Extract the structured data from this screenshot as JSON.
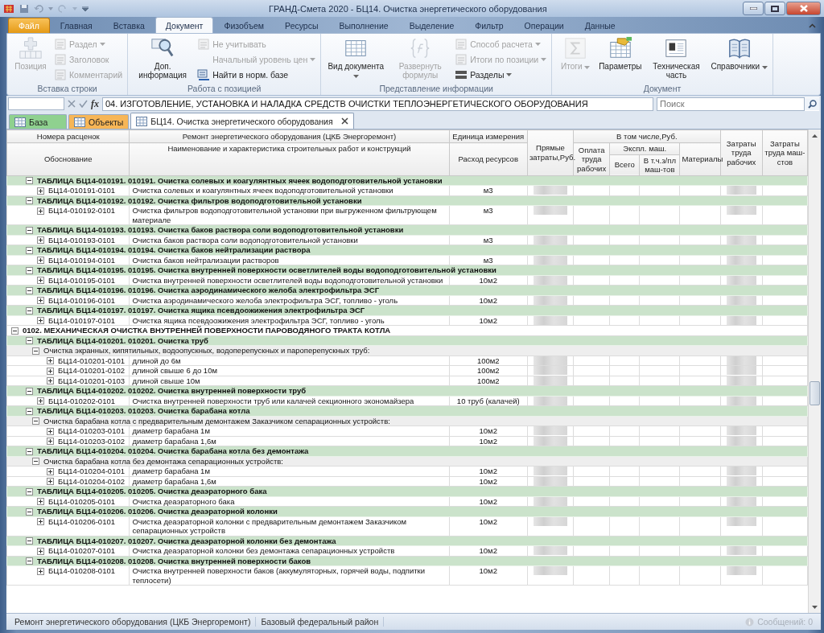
{
  "window": {
    "title": "ГРАНД-Смета 2020 - БЦ14. Очистка энергетического оборудования"
  },
  "ribbon": {
    "tabs": [
      {
        "label": "Файл",
        "kind": "file",
        "selected": false
      },
      {
        "label": "Главная",
        "kind": "tab",
        "selected": false
      },
      {
        "label": "Вставка",
        "kind": "tab",
        "selected": false
      },
      {
        "label": "Документ",
        "kind": "tab",
        "selected": true
      },
      {
        "label": "Физобъем",
        "kind": "tab",
        "selected": false
      },
      {
        "label": "Ресурсы",
        "kind": "tab",
        "selected": false
      },
      {
        "label": "Выполнение",
        "kind": "tab",
        "selected": false
      },
      {
        "label": "Выделение",
        "kind": "tab",
        "selected": false
      },
      {
        "label": "Фильтр",
        "kind": "tab",
        "selected": false
      },
      {
        "label": "Операции",
        "kind": "tab",
        "selected": false
      },
      {
        "label": "Данные",
        "kind": "tab",
        "selected": false
      }
    ],
    "groups": [
      {
        "title": "Вставка строки",
        "items": [
          {
            "kind": "large",
            "label": "Позиция",
            "disabled": true,
            "dropdown": false
          },
          {
            "kind": "small",
            "label": "Раздел",
            "disabled": true,
            "dropdown": true
          },
          {
            "kind": "small",
            "label": "Заголовок",
            "disabled": true,
            "dropdown": false
          },
          {
            "kind": "small",
            "label": "Комментарий",
            "disabled": true,
            "dropdown": false
          }
        ]
      },
      {
        "title": "Работа с позицией",
        "items": [
          {
            "kind": "large",
            "label": "Доп. информация",
            "disabled": false,
            "dropdown": false
          },
          {
            "kind": "small",
            "label": "Не учитывать",
            "disabled": true,
            "dropdown": false
          },
          {
            "kind": "small",
            "label": "Начальный уровень цен",
            "disabled": true,
            "dropdown": true
          },
          {
            "kind": "small",
            "label": "Найти в норм. базе",
            "disabled": false,
            "dropdown": false
          }
        ]
      },
      {
        "title": "Представление информации",
        "items": [
          {
            "kind": "large",
            "label": "Вид документа",
            "disabled": false,
            "dropdown": true
          },
          {
            "kind": "large",
            "label": "Развернуть формулы",
            "disabled": true,
            "dropdown": false
          },
          {
            "kind": "small",
            "label": "Способ расчета",
            "disabled": true,
            "dropdown": true
          },
          {
            "kind": "small",
            "label": "Итоги по позиции",
            "disabled": true,
            "dropdown": true
          },
          {
            "kind": "small",
            "label": "Разделы",
            "disabled": false,
            "dropdown": true
          }
        ]
      },
      {
        "title": "Документ",
        "items": [
          {
            "kind": "large",
            "label": "Итоги",
            "disabled": true,
            "dropdown": true
          },
          {
            "kind": "large",
            "label": "Параметры",
            "disabled": false,
            "dropdown": false
          },
          {
            "kind": "large",
            "label": "Техническая часть",
            "disabled": false,
            "dropdown": false
          },
          {
            "kind": "large",
            "label": "Справочники",
            "disabled": false,
            "dropdown": true
          }
        ]
      }
    ]
  },
  "formula_bar": {
    "function_label": "fx",
    "value": "04. ИЗГОТОВЛЕНИЕ, УСТАНОВКА И НАЛАДКА СРЕДСТВ ОЧИСТКИ ТЕПЛОЭНЕРГЕТИЧЕСКОГО ОБОРУДОВАНИЯ",
    "search_placeholder": "Поиск"
  },
  "doc_tabs": [
    {
      "label": "База",
      "selected": false,
      "color": "#8fd18f"
    },
    {
      "label": "Объекты",
      "selected": false,
      "color": "#f7b657"
    },
    {
      "label": "БЦ14. Очистка энергетического оборудования",
      "selected": true,
      "color": "#ffffff"
    }
  ],
  "grid": {
    "header": {
      "codes": "Номера расценок",
      "basis": "Обоснование",
      "collection": "Ремонт энергетического оборудования (ЦКБ Энергоремонт)",
      "name": "Наименование и характеристика строительных работ и конструкций",
      "unit": "Единица измерения",
      "consumption": "Расход ресурсов",
      "direct": "Прямые затраты,Руб.",
      "including": "В том числе,Руб.",
      "wages": "Оплата труда рабочих",
      "machines": "Экспл. маш.",
      "machines_total": "Всего",
      "machinist_wages": "В т.ч.з/пл маш-тов",
      "materials": "Материалы",
      "labor_workers": "Затраты труда рабочих",
      "labor_machinists": "Затраты труда маш-стов"
    },
    "rows": [
      {
        "kind": "table",
        "text": "ТАБЛИЦА БЦ14-010191. 010191. Очистка солевых и коагулянтных ячеек водоподготовительной установки",
        "expanded": true,
        "children": [
          {
            "kind": "item",
            "code": "БЦ14-010191-0101",
            "name": "Очистка солевых и коагулянтных ячеек водоподготовительной установки",
            "unit": "м3",
            "expanded": false
          }
        ]
      },
      {
        "kind": "table",
        "text": "ТАБЛИЦА БЦ14-010192. 010192. Очистка фильтров водоподготовительной установки",
        "expanded": true,
        "children": [
          {
            "kind": "item",
            "code": "БЦ14-010192-0101",
            "name": "Очистка фильтров водоподготовительной установки при выгруженном фильтрующем материале",
            "unit": "м3",
            "expanded": false
          }
        ]
      },
      {
        "kind": "table",
        "text": "ТАБЛИЦА БЦ14-010193. 010193. Очистка баков раствора соли водоподготовительной установки",
        "expanded": true,
        "children": [
          {
            "kind": "item",
            "code": "БЦ14-010193-0101",
            "name": "Очистка баков раствора соли водоподготовительной установки",
            "unit": "м3",
            "expanded": false
          }
        ]
      },
      {
        "kind": "table",
        "text": "ТАБЛИЦА БЦ14-010194. 010194. Очистка баков нейтрализации раствора",
        "expanded": true,
        "children": [
          {
            "kind": "item",
            "code": "БЦ14-010194-0101",
            "name": "Очистка баков нейтрализации растворов",
            "unit": "м3",
            "expanded": false
          }
        ]
      },
      {
        "kind": "table",
        "text": "ТАБЛИЦА БЦ14-010195. 010195. Очистка внутренней поверхности осветлителей воды водоподготовительной установки",
        "expanded": true,
        "children": [
          {
            "kind": "item",
            "code": "БЦ14-010195-0101",
            "name": "Очистка внутренней поверхности осветлителей воды водоподготовительной установки",
            "unit": "10м2",
            "expanded": false
          }
        ]
      },
      {
        "kind": "table",
        "text": "ТАБЛИЦА БЦ14-010196. 010196. Очистка аэродинамического желоба электрофильтра ЭСГ",
        "expanded": true,
        "children": [
          {
            "kind": "item",
            "code": "БЦ14-010196-0101",
            "name": "Очистка аэродинамического желоба электрофильтра ЭСГ, топливо - уголь",
            "unit": "10м2",
            "expanded": false
          }
        ]
      },
      {
        "kind": "table",
        "text": "ТАБЛИЦА БЦ14-010197. 010197. Очистка ящика псевдоожижения электрофильтра ЭСГ",
        "expanded": true,
        "children": [
          {
            "kind": "item",
            "code": "БЦ14-010197-0101",
            "name": "Очистка ящика псевдоожижения электрофильтра ЭСГ, топливо - уголь",
            "unit": "10м2",
            "expanded": false
          }
        ]
      },
      {
        "kind": "section",
        "text": "0102. МЕХАНИЧЕСКАЯ ОЧИСТКА ВНУТРЕННЕЙ ПОВЕРХНОСТИ ПАРОВОДЯНОГО ТРАКТА КОТЛА",
        "expanded": true,
        "children": [
          {
            "kind": "table",
            "text": "ТАБЛИЦА БЦ14-010201. 010201. Очистка труб",
            "expanded": true,
            "children": [
              {
                "kind": "sub",
                "text": "Очистка экранных, кипятильных, водоопускных, водоперепускных и пароперепускных труб:",
                "expanded": true,
                "children": [
                  {
                    "kind": "item",
                    "code": "БЦ14-010201-0101",
                    "name": "длиной до 6м",
                    "unit": "100м2",
                    "expanded": false
                  },
                  {
                    "kind": "item",
                    "code": "БЦ14-010201-0102",
                    "name": "длиной свыше 6 до 10м",
                    "unit": "100м2",
                    "expanded": false
                  },
                  {
                    "kind": "item",
                    "code": "БЦ14-010201-0103",
                    "name": "длиной свыше 10м",
                    "unit": "100м2",
                    "expanded": false
                  }
                ]
              }
            ]
          },
          {
            "kind": "table",
            "text": "ТАБЛИЦА БЦ14-010202. 010202. Очистка внутренней поверхности труб",
            "expanded": true,
            "children": [
              {
                "kind": "item",
                "code": "БЦ14-010202-0101",
                "name": "Очистка внутренней поверхности труб или калачей секционного экономайзера",
                "unit": "10 труб (калачей)",
                "expanded": false
              }
            ]
          },
          {
            "kind": "table",
            "text": "ТАБЛИЦА БЦ14-010203. 010203. Очистка барабана котла",
            "expanded": true,
            "children": [
              {
                "kind": "sub",
                "text": "Очистка барабана котла с предварительным демонтажем Заказчиком сепарационных устройств:",
                "expanded": true,
                "children": [
                  {
                    "kind": "item",
                    "code": "БЦ14-010203-0101",
                    "name": "диаметр барабана 1м",
                    "unit": "10м2",
                    "expanded": false
                  },
                  {
                    "kind": "item",
                    "code": "БЦ14-010203-0102",
                    "name": "диаметр барабана 1,6м",
                    "unit": "10м2",
                    "expanded": false
                  }
                ]
              }
            ]
          },
          {
            "kind": "table",
            "text": "ТАБЛИЦА БЦ14-010204. 010204. Очистка барабана котла без демонтажа",
            "expanded": true,
            "children": [
              {
                "kind": "sub",
                "text": "Очистка барабана котла без демонтажа сепарационных устройств:",
                "expanded": true,
                "children": [
                  {
                    "kind": "item",
                    "code": "БЦ14-010204-0101",
                    "name": "диаметр барабана 1м",
                    "unit": "10м2",
                    "expanded": false
                  },
                  {
                    "kind": "item",
                    "code": "БЦ14-010204-0102",
                    "name": "диаметр барабана 1,6м",
                    "unit": "10м2",
                    "expanded": false
                  }
                ]
              }
            ]
          },
          {
            "kind": "table",
            "text": "ТАБЛИЦА БЦ14-010205. 010205. Очистка деаэраторного бака",
            "expanded": true,
            "children": [
              {
                "kind": "item",
                "code": "БЦ14-010205-0101",
                "name": "Очистка деаэраторного бака",
                "unit": "10м2",
                "expanded": false
              }
            ]
          },
          {
            "kind": "table",
            "text": "ТАБЛИЦА БЦ14-010206. 010206. Очистка деаэраторной колонки",
            "expanded": true,
            "children": [
              {
                "kind": "item",
                "code": "БЦ14-010206-0101",
                "name": "Очистка деаэраторной колонки с предварительным демонтажем Заказчиком сепарационных устройств",
                "unit": "10м2",
                "expanded": false
              }
            ]
          },
          {
            "kind": "table",
            "text": "ТАБЛИЦА БЦ14-010207. 010207. Очистка деаэраторной колонки без демонтажа",
            "expanded": true,
            "children": [
              {
                "kind": "item",
                "code": "БЦ14-010207-0101",
                "name": "Очистка деаэраторной колонки без демонтажа сепарационных устройств",
                "unit": "10м2",
                "expanded": false
              }
            ]
          },
          {
            "kind": "table",
            "text": "ТАБЛИЦА БЦ14-010208. 010208. Очистка внутренней поверхности баков",
            "expanded": true,
            "children": [
              {
                "kind": "item",
                "code": "БЦ14-010208-0101",
                "name": "Очистка внутренней поверхности баков (аккумуляторных, горячей воды, подпитки теплосети)",
                "unit": "10м2",
                "expanded": false
              }
            ]
          }
        ]
      }
    ]
  },
  "status_bar": {
    "items": [
      "Ремонт энергетического оборудования (ЦКБ Энергоремонт)",
      "Базовый федеральный район"
    ],
    "messages": {
      "label": "Сообщений: 0",
      "disabled": true
    }
  }
}
